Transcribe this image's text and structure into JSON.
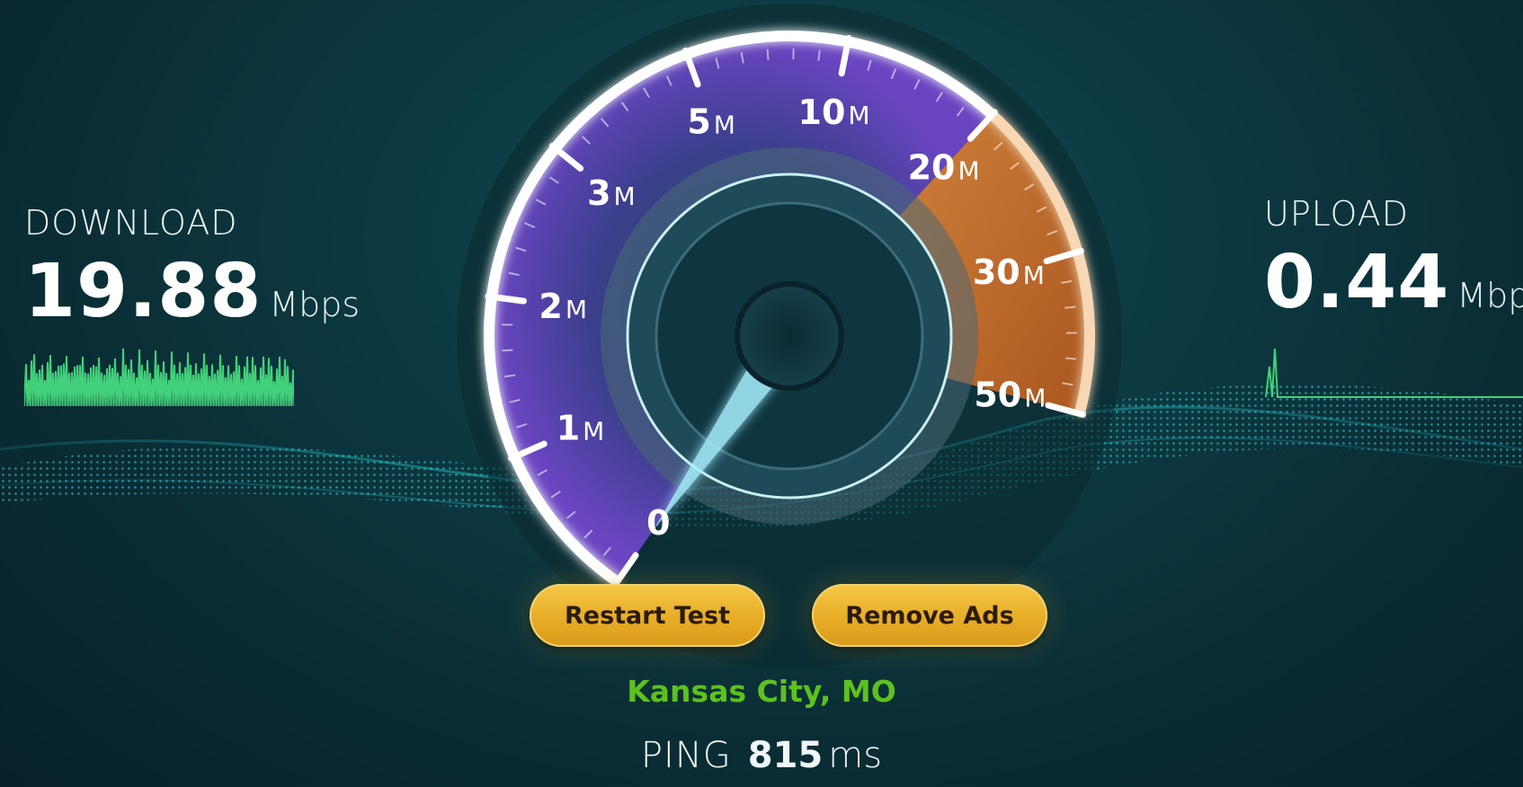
{
  "download": {
    "label": "DOWNLOAD",
    "value": "19.88",
    "unit": "Mbps"
  },
  "upload": {
    "label": "UPLOAD",
    "value": "0.44",
    "unit": "Mbps"
  },
  "gauge": {
    "ticks": [
      {
        "num": "0",
        "unit": ""
      },
      {
        "num": "1",
        "unit": "M"
      },
      {
        "num": "2",
        "unit": "M"
      },
      {
        "num": "3",
        "unit": "M"
      },
      {
        "num": "5",
        "unit": "M"
      },
      {
        "num": "10",
        "unit": "M"
      },
      {
        "num": "20",
        "unit": "M"
      },
      {
        "num": "30",
        "unit": "M"
      },
      {
        "num": "50",
        "unit": "M"
      }
    ],
    "current_speed_mbps": 0
  },
  "buttons": {
    "restart": "Restart Test",
    "remove_ads": "Remove Ads"
  },
  "server": {
    "location": "Kansas City, MO"
  },
  "ping": {
    "label": "PING",
    "value": "815",
    "unit": "ms"
  },
  "colors": {
    "accent_gold": "#eab12b",
    "location_green": "#5cc21d",
    "gauge_purple": "#5a3aa8",
    "gauge_orange": "#e0873a",
    "needle": "#a8f0ff"
  }
}
